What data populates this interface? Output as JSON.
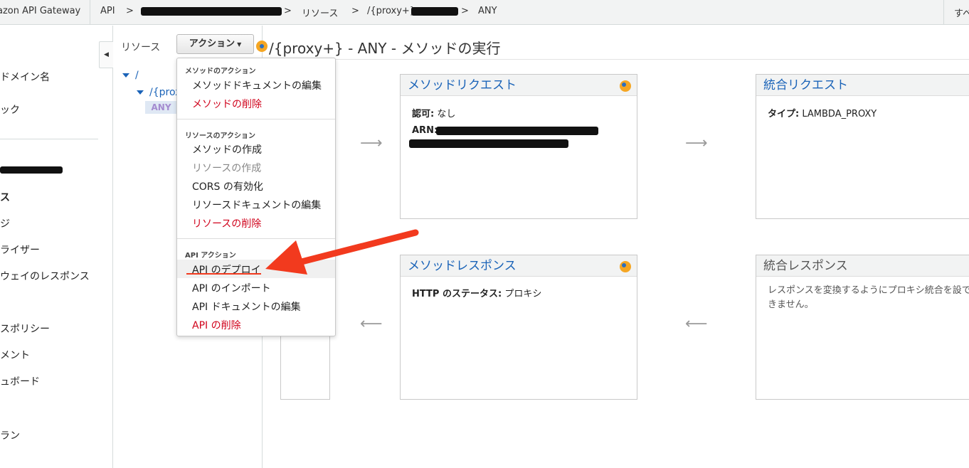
{
  "topbar": {
    "brand": "azon API Gateway",
    "crumbs": [
      "API",
      ">",
      ">",
      "リソース",
      ">",
      "/{proxy+}",
      ">",
      "ANY"
    ],
    "right": "すべ"
  },
  "leftnav": {
    "items": [
      "ドメイン名",
      "ック",
      "ス",
      "ジ",
      "ライザー",
      "ウェイのレスポンス",
      "スポリシー",
      "メント",
      "ュボード",
      "ラン"
    ]
  },
  "tree": {
    "label": "リソース",
    "actions_button": "アクション",
    "root": "/",
    "proxy": "/{prox",
    "any": "ANY"
  },
  "main": {
    "title": "/{proxy+} - ANY - メソッドの実行"
  },
  "method_request": {
    "title": "メソッドリクエスト",
    "auth_label": "認可:",
    "auth_value": "なし",
    "arn_label": "ARN:"
  },
  "integration_request": {
    "title": "統合リクエスト",
    "type_label": "タイプ:",
    "type_value": "LAMBDA_PROXY"
  },
  "method_response": {
    "title": "メソッドレスポンス",
    "status_label": "HTTP のステータス:",
    "status_value": "プロキシ"
  },
  "integration_response": {
    "title": "統合レスポンス",
    "note": "レスポンスを変換するようにプロキシ統合を設できません。"
  },
  "menu": {
    "method_section": "メソッドのアクション",
    "method_items": [
      "メソッドドキュメントの編集",
      "メソッドの削除"
    ],
    "resource_section": "リソースのアクション",
    "resource_items": [
      "メソッドの作成",
      "リソースの作成",
      "CORS の有効化",
      "リソースドキュメントの編集",
      "リソースの削除"
    ],
    "api_section": "API アクション",
    "api_items": [
      "API のデプロイ",
      "API のインポート",
      "API ドキュメントの編集",
      "API の削除"
    ]
  },
  "colors": {
    "link_blue": "#1a63b8",
    "danger_red": "#d0021b",
    "annotation_red": "#f23a1e",
    "status_orange": "#f5a623"
  }
}
